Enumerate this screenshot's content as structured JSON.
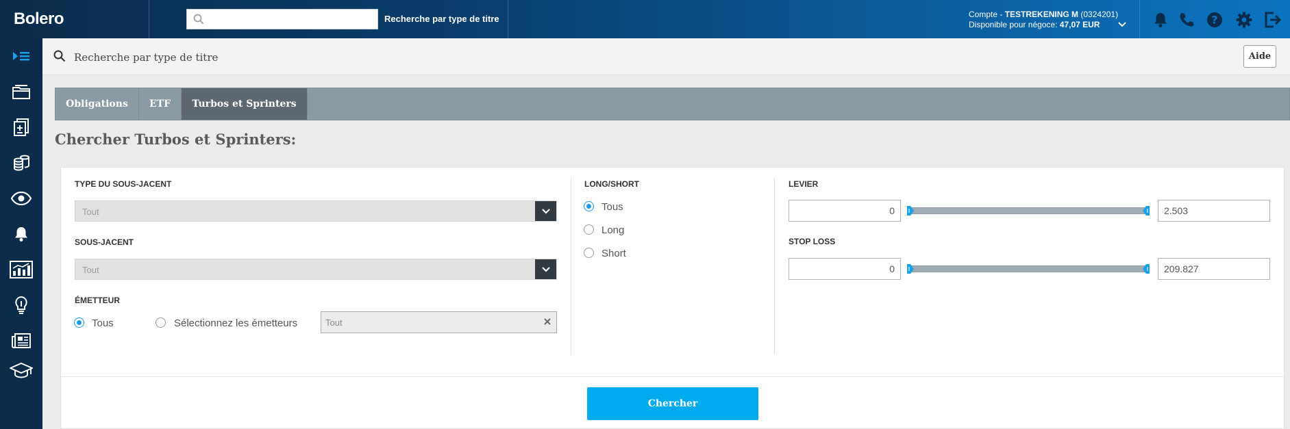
{
  "brand": "Bolero",
  "topbar": {
    "search_placeholder": "",
    "search_link": "Recherche par type de titre",
    "account_prefix": "Compte - ",
    "account_name": "TESTREKENING M",
    "account_number": "(0324201)",
    "available_label": "Disponible pour négoce: ",
    "available_amount": "47,07 EUR"
  },
  "strip": {
    "text": "Recherche par type de titre",
    "help_button": "Aide"
  },
  "tabs": [
    {
      "label": "Obligations",
      "active": false
    },
    {
      "label": "ETF",
      "active": false
    },
    {
      "label": "Turbos et Sprinters",
      "active": true
    }
  ],
  "section_title": "Chercher Turbos et Sprinters:",
  "form": {
    "underlying_type": {
      "label": "TYPE DU SOUS-JACENT",
      "value": "Tout"
    },
    "underlying": {
      "label": "SOUS-JACENT",
      "value": "Tout"
    },
    "issuer": {
      "label": "ÉMETTEUR",
      "options": [
        "Tous",
        "Sélectionnez les émetteurs"
      ],
      "selected": "Tous",
      "picker_value": "Tout"
    },
    "long_short": {
      "label": "LONG/SHORT",
      "options": [
        "Tous",
        "Long",
        "Short"
      ],
      "selected": "Tous"
    },
    "leverage": {
      "label": "LEVIER",
      "min": "0",
      "max": "2.503"
    },
    "stop_loss": {
      "label": "STOP LOSS",
      "min": "0",
      "max": "209.827"
    },
    "submit": "Chercher"
  },
  "colors": {
    "accent": "#00aaef",
    "nav_dark": "#0a2b4a",
    "tab_active": "#5d6870",
    "radio_on": "#1a9be0"
  },
  "icons": {
    "topbar": [
      "bell-icon",
      "phone-icon",
      "help-icon",
      "gear-icon",
      "logout-icon"
    ],
    "sidebar": [
      "menu-expand-icon",
      "portfolio-icon",
      "orders-icon",
      "coins-icon",
      "eye-icon",
      "alert-bell-icon",
      "chart-icon",
      "idea-icon",
      "news-icon",
      "education-icon"
    ]
  }
}
